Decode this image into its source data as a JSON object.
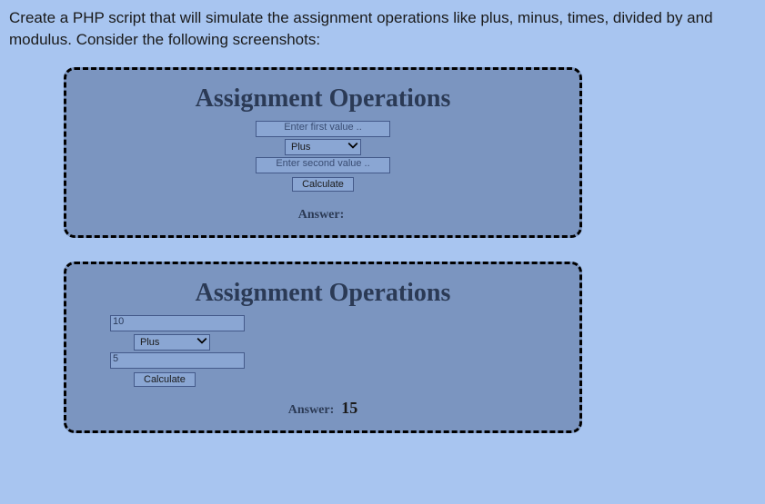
{
  "instruction": "Create a PHP script that will simulate the assignment operations like plus, minus, times, divided by and modulus. Consider the following screenshots:",
  "card1": {
    "title": "Assignment Operations",
    "input1_placeholder": "Enter first value ..",
    "input1_value": "",
    "operator_selected": "Plus",
    "input2_placeholder": "Enter second value ..",
    "input2_value": "",
    "button_label": "Calculate",
    "answer_label": "Answer:",
    "answer_value": ""
  },
  "card2": {
    "title": "Assignment Operations",
    "input1_placeholder": "",
    "input1_value": "10",
    "operator_selected": "Plus",
    "input2_placeholder": "",
    "input2_value": "5",
    "button_label": "Calculate",
    "answer_label": "Answer:",
    "answer_value": "15"
  }
}
